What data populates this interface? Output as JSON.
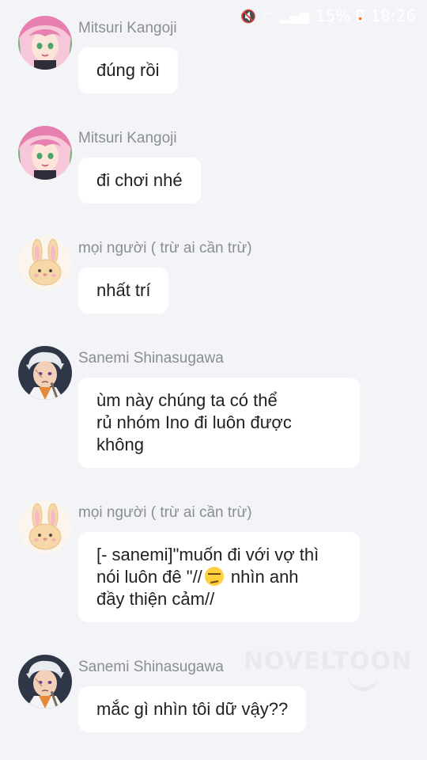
{
  "status_bar": {
    "battery": "15%",
    "time": "18:26",
    "icons": [
      "mute-icon",
      "wifi-icon",
      "signal-icon",
      "battery-icon"
    ]
  },
  "watermark": "NOVELTOON",
  "messages": [
    {
      "sender": "Mitsuri Kangoji",
      "avatar": "mitsuri-avatar",
      "text": "đúng rồi"
    },
    {
      "sender": "Mitsuri Kangoji",
      "avatar": "mitsuri-avatar",
      "text": "đi chơi nhé"
    },
    {
      "sender": "mọi người ( trừ ai cần trừ)",
      "avatar": "bunny-avatar",
      "text": "nhất trí"
    },
    {
      "sender": "Sanemi Shinasugawa",
      "avatar": "sanemi-avatar",
      "text": "ùm này chúng ta có thể\nrủ nhóm Ino đi luôn được\nkhông"
    },
    {
      "sender": "mọi người ( trừ ai cần trừ)",
      "avatar": "bunny-avatar",
      "text_part1": "[- sanemi]\"muốn đi với vợ thì\nnói luôn đê \"//",
      "emoji": "smirk-emoji",
      "text_part2": " nhìn anh\nđầy thiện cảm//"
    },
    {
      "sender": "Sanemi Shinasugawa",
      "avatar": "sanemi-avatar",
      "text": "mắc gì nhìn tôi dữ vậy??"
    }
  ]
}
